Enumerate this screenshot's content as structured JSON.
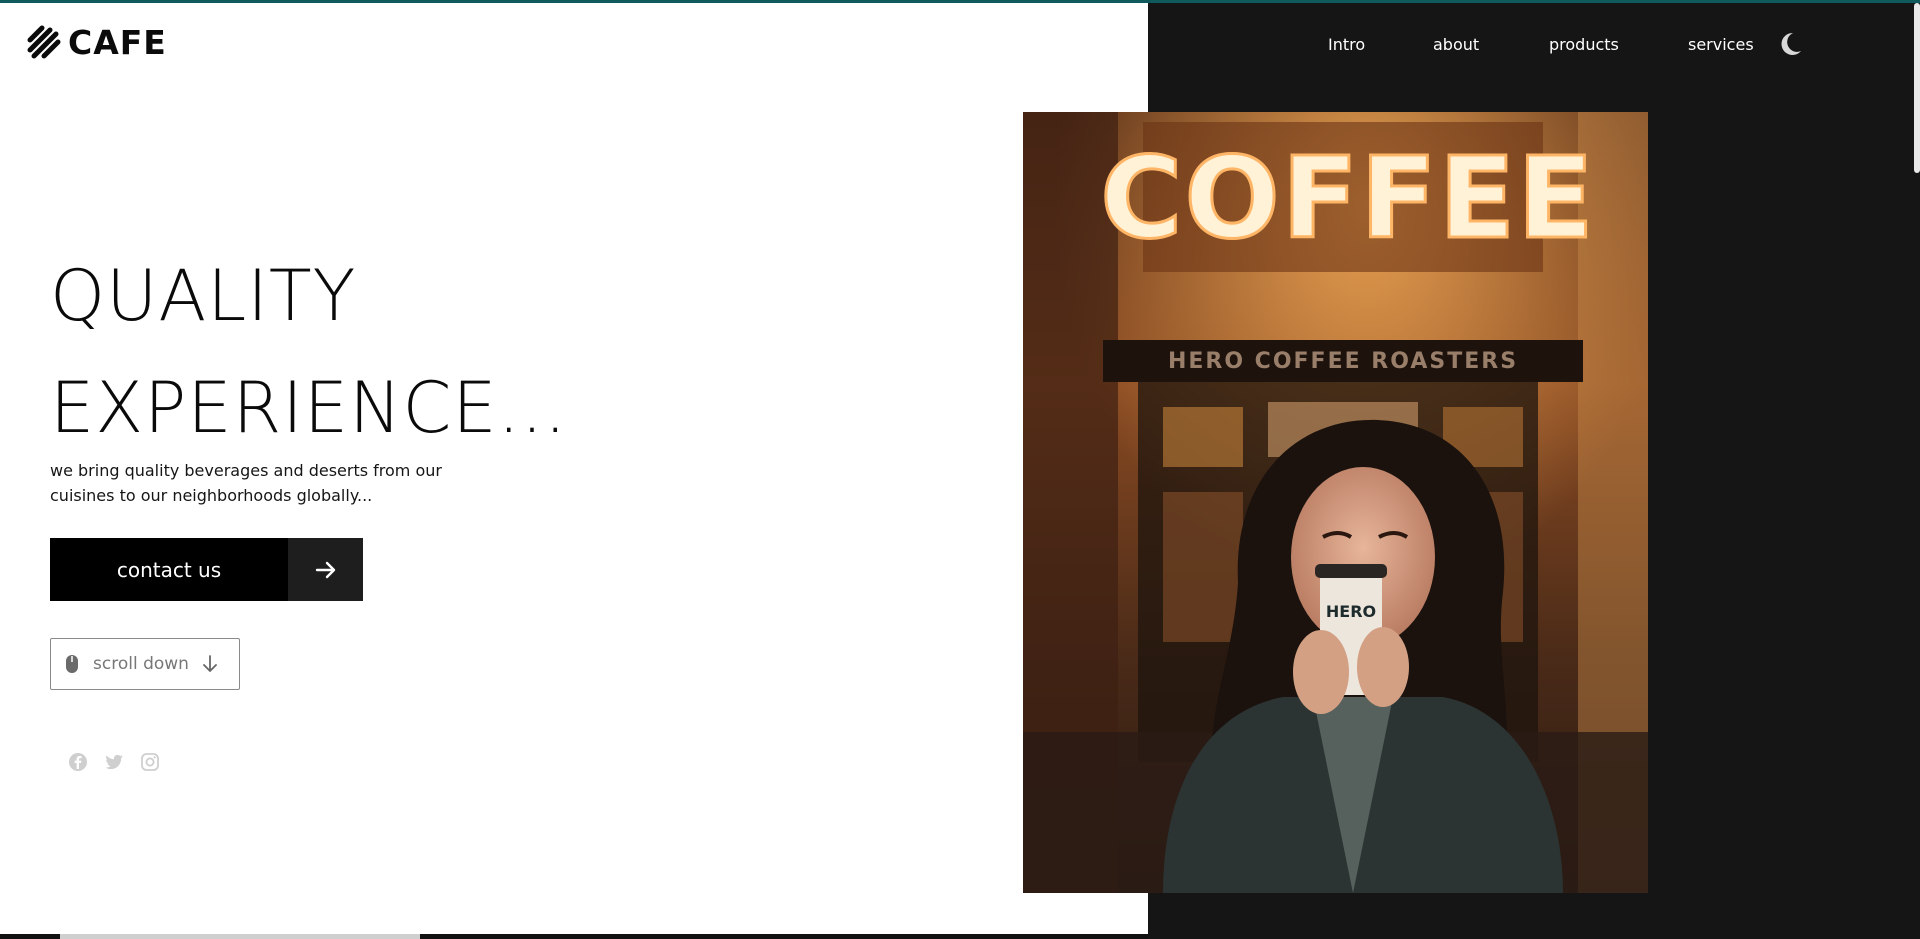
{
  "brand": {
    "logo_text": "CAFE"
  },
  "nav": {
    "links": [
      "Intro",
      "about",
      "products",
      "services"
    ],
    "theme_toggle_icon": "moon-icon"
  },
  "hero": {
    "title_line1": "QUALITY",
    "title_line2": "EXPERIENCE...",
    "subtitle": "we bring quality beverages and deserts from our cuisines to our neighborhoods globally...",
    "cta_label": "contact us",
    "scroll_label": "scroll down"
  },
  "photo": {
    "sign_text": "COFFEE",
    "awning_text": "HERO COFFEE ROASTERS",
    "cup_text": "HERO"
  },
  "socials": [
    "facebook-icon",
    "twitter-icon",
    "instagram-icon"
  ],
  "colors": {
    "accent": "#0f5a5a",
    "panel": "#151515",
    "button": "#000000"
  }
}
